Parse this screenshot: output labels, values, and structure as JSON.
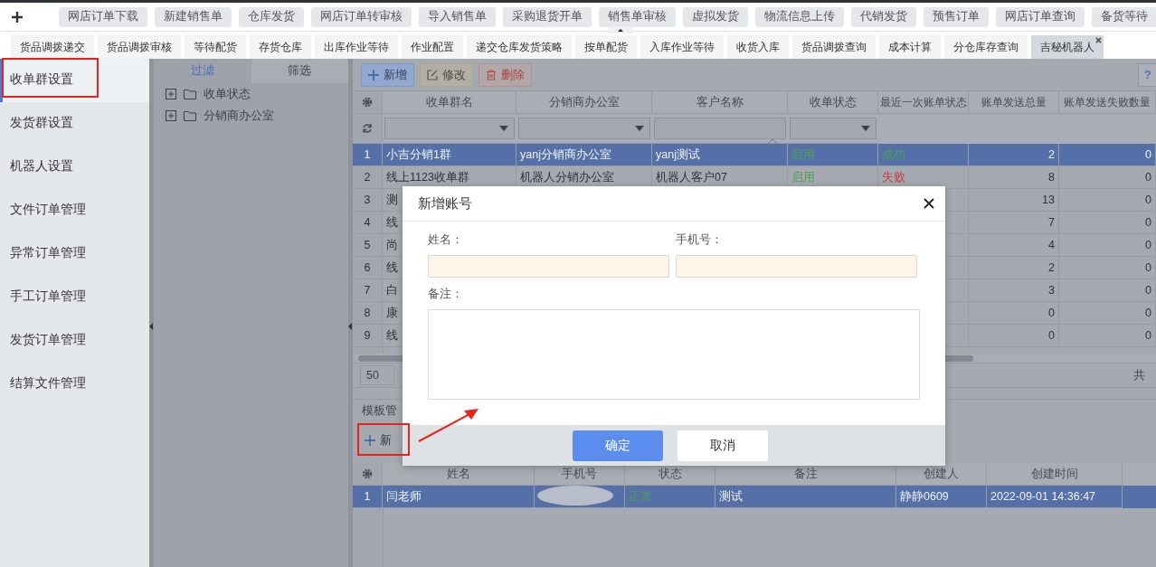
{
  "top_actions": [
    "网店订单下载",
    "新建销售单",
    "仓库发货",
    "网店订单转审核",
    "导入销售单",
    "采购退货开单",
    "销售单审核",
    "虚拟发货",
    "物流信息上传",
    "代销发货",
    "预售订单",
    "网店订单查询",
    "备货等待"
  ],
  "open_tabs": [
    {
      "label": "货品调拨递交",
      "selected": false
    },
    {
      "label": "货品调拨审核",
      "selected": false
    },
    {
      "label": "等待配货",
      "selected": false
    },
    {
      "label": "存货仓库",
      "selected": false
    },
    {
      "label": "出库作业等待",
      "selected": false
    },
    {
      "label": "作业配置",
      "selected": false
    },
    {
      "label": "递交仓库发货策略",
      "selected": false
    },
    {
      "label": "按单配货",
      "selected": false
    },
    {
      "label": "入库作业等待",
      "selected": false
    },
    {
      "label": "收货入库",
      "selected": false
    },
    {
      "label": "货品调拨查询",
      "selected": false
    },
    {
      "label": "成本计算",
      "selected": false
    },
    {
      "label": "分仓库存查询",
      "selected": false
    },
    {
      "label": "吉秘机器人",
      "selected": true
    }
  ],
  "sidebar": [
    {
      "label": "收单群设置",
      "selected": true
    },
    {
      "label": "发货群设置",
      "selected": false
    },
    {
      "label": "机器人设置",
      "selected": false
    },
    {
      "label": "文件订单管理",
      "selected": false
    },
    {
      "label": "异常订单管理",
      "selected": false
    },
    {
      "label": "手工订单管理",
      "selected": false
    },
    {
      "label": "发货订单管理",
      "selected": false
    },
    {
      "label": "结算文件管理",
      "selected": false
    }
  ],
  "filter_panel": {
    "tabs": [
      {
        "label": "过滤",
        "selected": true
      },
      {
        "label": "筛选",
        "selected": false
      }
    ],
    "tree": [
      {
        "label": "收单状态",
        "expanded": false
      },
      {
        "label": "分销商办公室",
        "expanded": false
      }
    ]
  },
  "grid": {
    "actions": [
      {
        "label": "新增",
        "kind": "add"
      },
      {
        "label": "修改",
        "kind": "edit"
      },
      {
        "label": "删除",
        "kind": "delete"
      }
    ],
    "help": "?",
    "columns": [
      "收单群名",
      "分销商办公室",
      "客户名称",
      "收单状态",
      "最近一次账单状态",
      "账单发送总量",
      "账单发送失败数量"
    ],
    "filters": [
      {
        "kind": "select"
      },
      {
        "kind": "select"
      },
      {
        "kind": "input"
      },
      {
        "kind": "select"
      }
    ],
    "rows": [
      {
        "number": "1",
        "cells": [
          "小吉分销1群",
          "yanj分销商办公室",
          "yanj测试"
        ],
        "status": {
          "text": "启用",
          "color": "#4f9e57"
        },
        "bill": {
          "text": "成功",
          "color": "#4f9e57"
        },
        "total": "2",
        "failed": "0",
        "selected": true
      },
      {
        "number": "2",
        "cells": [
          "线上1123收单群",
          "机器人分销办公室",
          "机器人客户07"
        ],
        "status": {
          "text": "启用",
          "color": "#4f9e57"
        },
        "bill": {
          "text": "失败",
          "color": "#c83c3c"
        },
        "total": "8",
        "failed": "0",
        "selected": false
      },
      {
        "number": "3",
        "cells": [
          "测"
        ],
        "total": "13",
        "failed": "0",
        "selected": false
      },
      {
        "number": "4",
        "cells": [
          "线"
        ],
        "total": "7",
        "failed": "0",
        "selected": false
      },
      {
        "number": "5",
        "cells": [
          "尚"
        ],
        "total": "4",
        "failed": "0",
        "selected": false
      },
      {
        "number": "6",
        "cells": [
          "线"
        ],
        "total": "2",
        "failed": "0",
        "selected": false
      },
      {
        "number": "7",
        "cells": [
          "白"
        ],
        "total": "3",
        "failed": "0",
        "selected": false
      },
      {
        "number": "8",
        "cells": [
          "康"
        ],
        "total": "0",
        "failed": "0",
        "selected": false
      },
      {
        "number": "9",
        "cells": [
          "线"
        ],
        "total": "0",
        "failed": "0",
        "selected": false
      }
    ],
    "pager": {
      "page_size": "50",
      "total": "共"
    }
  },
  "template": {
    "title": "模板管",
    "add": "新",
    "columns": [
      "姓名",
      "手机号",
      "状态",
      "备注",
      "创建人",
      "创建时间"
    ],
    "rows": [
      {
        "number": "1",
        "name": "闫老师",
        "status": {
          "text": "正常",
          "color": "#4f9e57"
        },
        "note": "测试",
        "creator": "静静0609",
        "created": "2022-09-01 14:36:47",
        "selected": true
      }
    ]
  },
  "dialog": {
    "title": "新增账号",
    "fields": [
      {
        "label": "姓名：",
        "kind": "input"
      },
      {
        "label": "手机号：",
        "kind": "input"
      }
    ],
    "note_label": "备注：",
    "buttons": [
      {
        "label": "确定",
        "kind": "primary"
      },
      {
        "label": "取消",
        "kind": "default"
      }
    ]
  }
}
